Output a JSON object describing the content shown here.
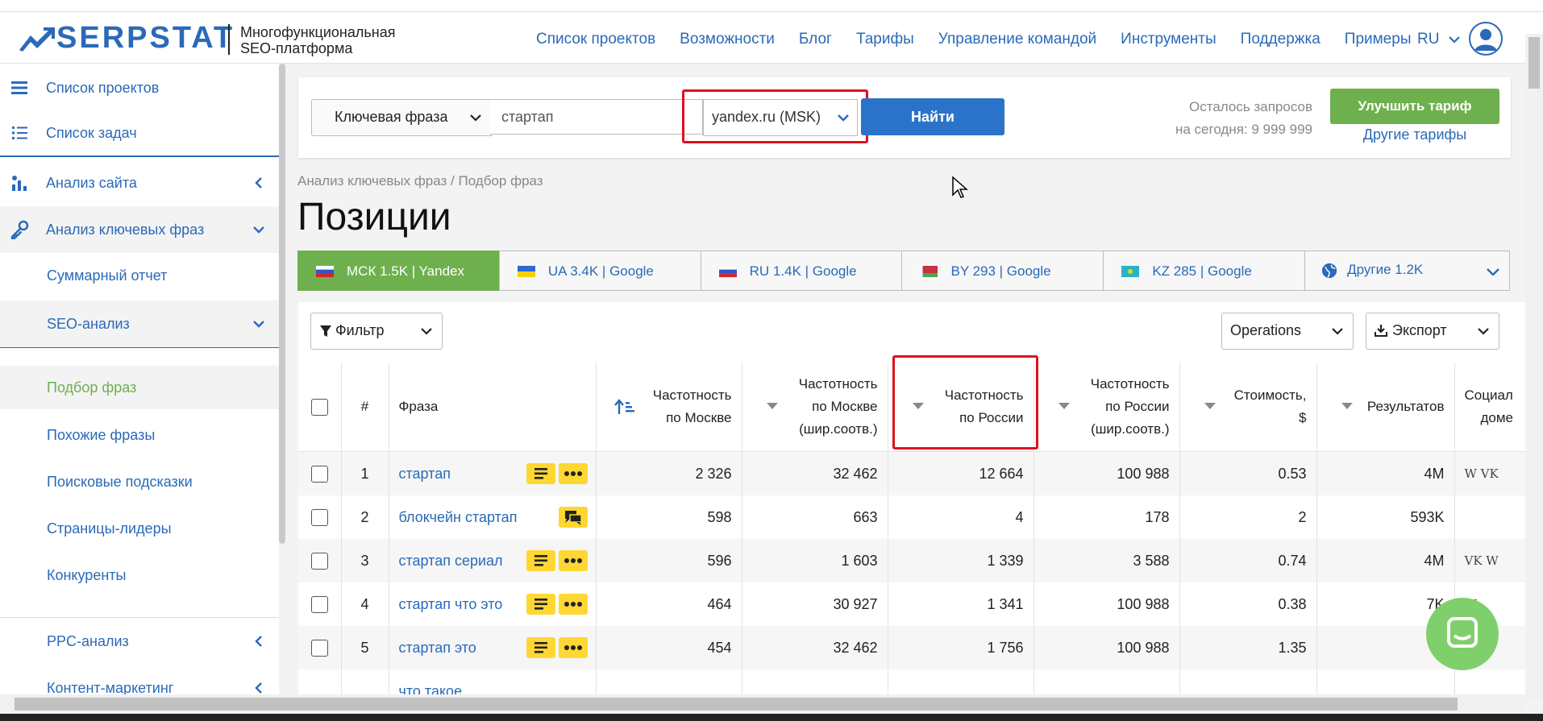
{
  "header": {
    "logo_text": "SERPSTAT",
    "tagline_line1": "Многофункциональная",
    "tagline_line2": "SEO-платформа",
    "nav": [
      "Список проектов",
      "Возможности",
      "Блог",
      "Тарифы",
      "Управление командой",
      "Инструменты",
      "Поддержка",
      "Примеры"
    ],
    "lang": "RU"
  },
  "sidebar": {
    "items": [
      {
        "label": "Список проектов",
        "icon": "hamburger-icon"
      },
      {
        "label": "Список задач",
        "icon": "task-list-icon"
      },
      {
        "label": "Анализ сайта",
        "icon": "site-analysis-icon"
      },
      {
        "label": "Анализ ключевых фраз",
        "icon": "key-icon"
      }
    ],
    "sub_items": [
      "Суммарный отчет",
      "SEO-анализ",
      "Подбор фраз",
      "Похожие фразы",
      "Поисковые подсказки",
      "Страницы-лидеры",
      "Конкуренты"
    ],
    "groups": [
      "PPC-анализ",
      "Контент-маркетинг"
    ]
  },
  "search": {
    "type_label": "Ключевая фраза",
    "query": "стартап",
    "database": "yandex.ru (MSK)",
    "find_label": "Найти",
    "remaining_line1": "Осталось запросов",
    "remaining_line2": "на сегодня: 9 999 999",
    "upgrade_label": "Улучшить тариф",
    "other_plans_label": "Другие тарифы"
  },
  "breadcrumb": "Анализ ключевых фраз / Подбор фраз",
  "page_title": "Позиции",
  "region_tabs": [
    {
      "label": "МСК 1.5K | Yandex",
      "flag": "ru"
    },
    {
      "label": "UA 3.4K | Google",
      "flag": "ua"
    },
    {
      "label": "RU 1.4K | Google",
      "flag": "ru"
    },
    {
      "label": "BY 293 | Google",
      "flag": "by"
    },
    {
      "label": "KZ 285 | Google",
      "flag": "kz"
    },
    {
      "label": "Другие 1.2K",
      "flag": "globe"
    }
  ],
  "toolbar": {
    "filter_label": "Фильтр",
    "operations_label": "Operations",
    "export_label": "Экспорт"
  },
  "table": {
    "headers": {
      "num": "#",
      "phrase": "Фраза",
      "freq_moscow": [
        "Частотность",
        "по Москве"
      ],
      "freq_moscow_broad": [
        "Частотность",
        "по Москве",
        "(шир.соотв.)"
      ],
      "freq_russia": [
        "Частотность",
        "по России"
      ],
      "freq_russia_broad": [
        "Частотность",
        "по России",
        "(шир.соотв.)"
      ],
      "cost": [
        "Стоимость,",
        "$"
      ],
      "results": "Результатов",
      "social": [
        "Социал",
        "доме"
      ]
    },
    "rows": [
      {
        "n": "1",
        "phrase": "стартап",
        "m": "2 326",
        "mb": "32 462",
        "r": "12 664",
        "rb": "100 988",
        "cost": "0.53",
        "res": "4M",
        "badges": [
          "lines",
          "dots"
        ],
        "social": "W VK"
      },
      {
        "n": "2",
        "phrase": "блокчейн стартап",
        "m": "598",
        "mb": "663",
        "r": "4",
        "rb": "178",
        "cost": "2",
        "res": "593K",
        "badges": [
          "chat"
        ],
        "social": ""
      },
      {
        "n": "3",
        "phrase": "стартап сериал",
        "m": "596",
        "mb": "1 603",
        "r": "1 339",
        "rb": "3 588",
        "cost": "0.74",
        "res": "4M",
        "badges": [
          "lines",
          "dots"
        ],
        "social": "VK W"
      },
      {
        "n": "4",
        "phrase": "стартап что это",
        "m": "464",
        "mb": "30 927",
        "r": "1 341",
        "rb": "100 988",
        "cost": "0.38",
        "res": "7K",
        "badges": [
          "lines",
          "dots"
        ],
        "social": "W"
      },
      {
        "n": "5",
        "phrase": "стартап это",
        "m": "454",
        "mb": "32 462",
        "r": "1 756",
        "rb": "100 988",
        "cost": "1.35",
        "res": "",
        "badges": [
          "lines",
          "dots"
        ],
        "social": ""
      },
      {
        "n": "",
        "phrase": "что такое",
        "m": "",
        "mb": "",
        "r": "",
        "rb": "",
        "cost": "",
        "res": "",
        "badges": [],
        "social": ""
      }
    ]
  },
  "colors": {
    "brand_blue": "#2a6ab8",
    "green": "#6eb04d",
    "highlight_red": "#e0101e",
    "badge_yellow": "#ffd732"
  }
}
